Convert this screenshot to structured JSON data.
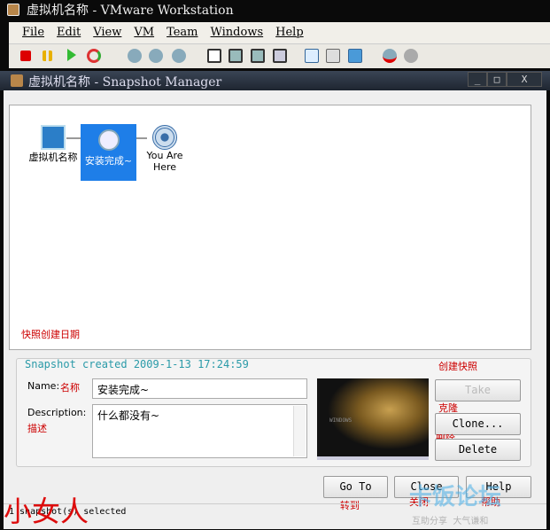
{
  "app": {
    "title": "虚拟机名称 - VMware Workstation",
    "menu": [
      "File",
      "Edit",
      "View",
      "VM",
      "Team",
      "Windows",
      "Help"
    ]
  },
  "dialog": {
    "title": "虚拟机名称 - Snapshot Manager",
    "window_buttons": [
      "_",
      "□",
      "X"
    ]
  },
  "tree": {
    "nodes": [
      {
        "label": "虚拟机名称",
        "icon": "vm-icon"
      },
      {
        "label": "安装完成~",
        "icon": "snapshot-clock-icon",
        "selected": true
      },
      {
        "label": "You Are Here",
        "icon": "you-are-here-icon"
      }
    ]
  },
  "details": {
    "created": "Snapshot created 2009-1-13 17:24:59",
    "name_label": "Name:",
    "name_value": "安装完成~",
    "description_label": "Description:",
    "description_value": "什么都没有~",
    "thumbnail_text": "WINDOWS"
  },
  "buttons": {
    "take_snapshot": "Take Snapshot...",
    "clone": "Clone...",
    "delete": "Delete",
    "goto": "Go To",
    "close": "Close",
    "help": "Help"
  },
  "status": "1 snapshot(s) selected",
  "annotations": {
    "date": "快照创建日期",
    "name": "名称",
    "description": "描述",
    "take": "创建快照",
    "clone": "克隆",
    "delete": "删除",
    "goto": "转到",
    "close": "关闭",
    "help": "帮助",
    "signature": "小女人"
  },
  "watermark": {
    "title": "卡饭论坛",
    "subtitle": "互助分享  大气谦和"
  },
  "colors": {
    "selection": "#1e7ee8",
    "annotation": "#cc0000",
    "created_text": "#2a9aa8"
  }
}
